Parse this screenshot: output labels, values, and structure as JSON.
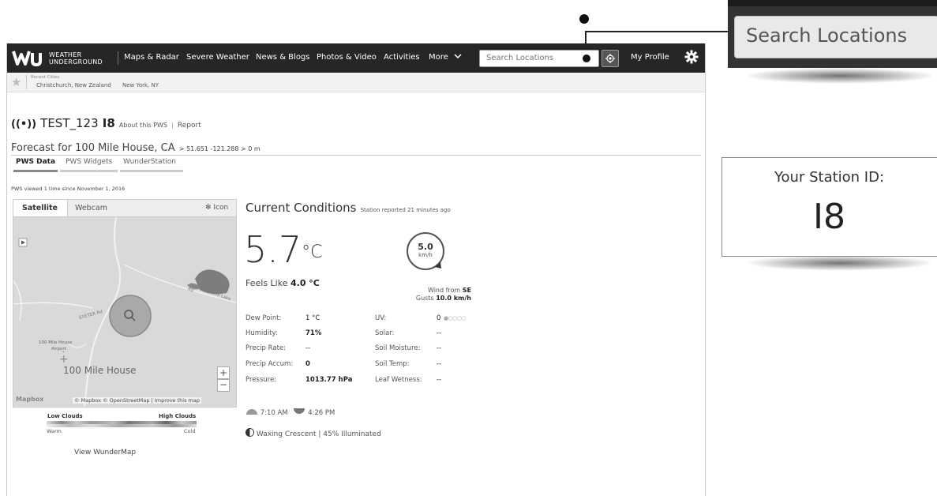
{
  "nav": {
    "brand_line1": "WEATHER",
    "brand_line2": "UNDERGROUND",
    "items": [
      "Maps & Radar",
      "Severe Weather",
      "News & Blogs",
      "Photos & Video",
      "Activities",
      "More"
    ],
    "more_chevron": "chevron-down-icon",
    "search_placeholder": "Search Locations",
    "profile": "My Profile",
    "settings_icon": "gear-icon"
  },
  "recent": {
    "label": "Recent Cities",
    "cities": [
      "Christchurch, New Zealand",
      "New York, NY"
    ]
  },
  "station": {
    "name": "TEST_123",
    "id": "I8",
    "about": "About this PWS",
    "separator": "|",
    "report": "Report"
  },
  "forecast": {
    "title": "Forecast for 100 Mile House, CA",
    "coords": "> 51.651 -121.288 > 0 m"
  },
  "tabs": [
    "PWS Data",
    "PWS Widgets",
    "WunderStation"
  ],
  "viewed": "PWS viewed 1 time since November 1, 2016",
  "map": {
    "tabs": [
      "Satellite",
      "Webcam"
    ],
    "icon_label": "Icon",
    "place": "100 Mile House",
    "small_place": "100 Mile House",
    "airport": "Airport",
    "attribution": "© Mapbox © OpenStreetMap | Improve this map",
    "mapbox": "Mapbox",
    "zoom_in": "+",
    "zoom_out": "−",
    "road1": "EXETER Rd",
    "road2": "Canim Hendrix Lake Rd"
  },
  "legend": {
    "low": "Low Clouds",
    "high": "High Clouds",
    "warm": "Warm",
    "cold": "Cold",
    "view_map": "View WunderMap"
  },
  "conditions": {
    "title": "Current Conditions",
    "reported": "Station reported 21 minutes ago",
    "temp": "5.7",
    "unit": "°C",
    "feels_label": "Feels Like",
    "feels_value": "4.0 °C",
    "wind_speed": "5.0",
    "wind_unit": "km/h",
    "wind_from_label": "Wind from",
    "wind_dir": "SE",
    "gusts_label": "Gusts",
    "gusts_value": "10.0 km/h",
    "left": [
      {
        "label": "Dew Point:",
        "value": "1 °C"
      },
      {
        "label": "Humidity:",
        "value": "71%"
      },
      {
        "label": "Precip Rate:",
        "value": "--"
      },
      {
        "label": "Precip Accum:",
        "value": "0"
      },
      {
        "label": "Pressure:",
        "value": "1013.77 hPa"
      }
    ],
    "right": [
      {
        "label": "UV:",
        "value": "0"
      },
      {
        "label": "Solar:",
        "value": "--"
      },
      {
        "label": "Soil Moisture:",
        "value": "--"
      },
      {
        "label": "Soil Temp:",
        "value": "--"
      },
      {
        "label": "Leaf Wetness:",
        "value": "--"
      }
    ],
    "sunrise": "7:10 AM",
    "sunset": "4:26 PM",
    "moon": "Waxing Crescent | 45% Illuminated"
  },
  "callouts": {
    "search": "Search Locations",
    "station_label": "Your Station ID:",
    "station_id": "I8"
  }
}
